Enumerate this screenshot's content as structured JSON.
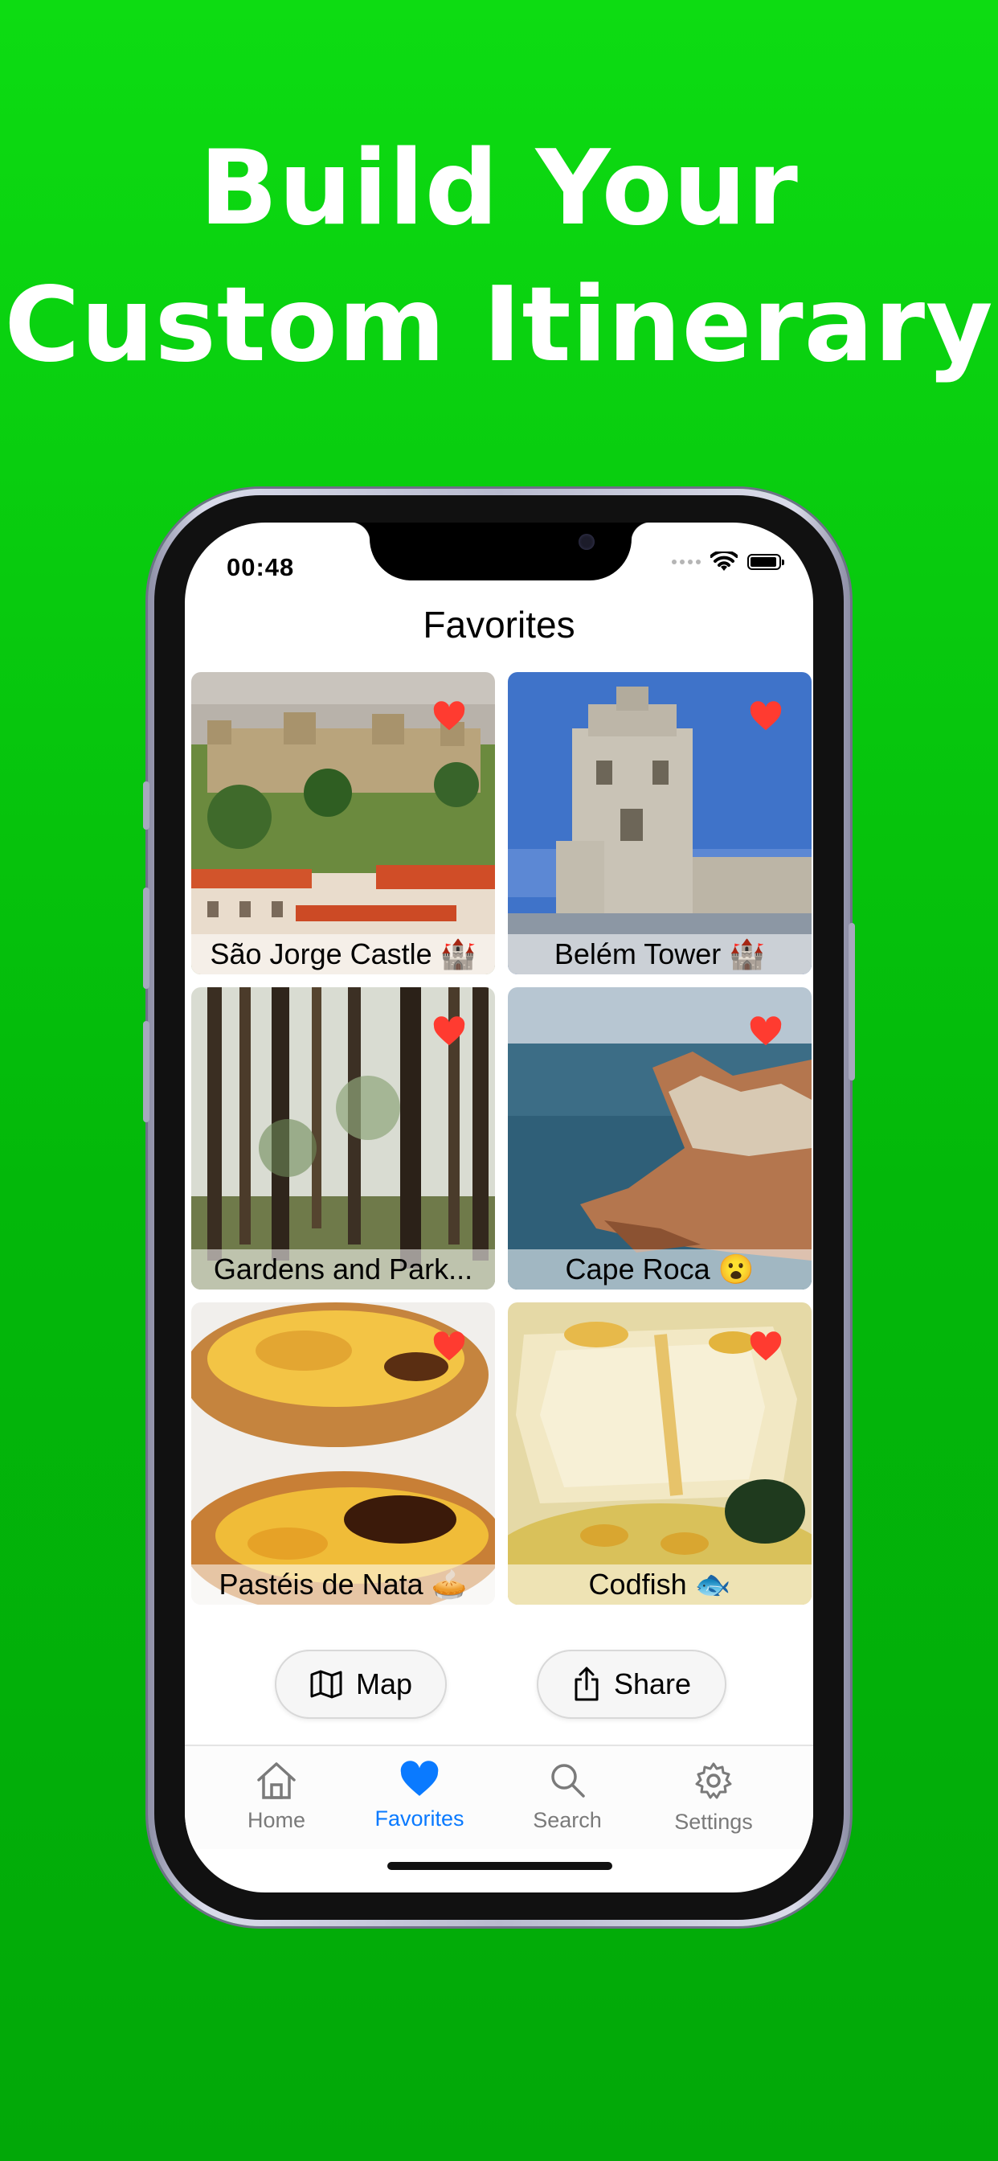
{
  "headline": {
    "line1": "Build Your",
    "line2": "Custom Itinerary"
  },
  "status_bar": {
    "time": "00:48"
  },
  "screen": {
    "title": "Favorites"
  },
  "favorites": [
    {
      "label": "São Jorge Castle 🏰"
    },
    {
      "label": "Belém Tower 🏰"
    },
    {
      "label": "Gardens and Park..."
    },
    {
      "label": "Cape Roca 😮"
    },
    {
      "label": "Pastéis de Nata 🥧"
    },
    {
      "label": "Codfish 🐟"
    }
  ],
  "actions": {
    "map_label": "Map",
    "share_label": "Share"
  },
  "tabbar": {
    "items": [
      {
        "label": "Home"
      },
      {
        "label": "Favorites"
      },
      {
        "label": "Search"
      },
      {
        "label": "Settings"
      }
    ],
    "active": "Favorites"
  },
  "colors": {
    "background": "#07c90c",
    "accent": "#0a7aff",
    "heart": "#ff3b30"
  }
}
